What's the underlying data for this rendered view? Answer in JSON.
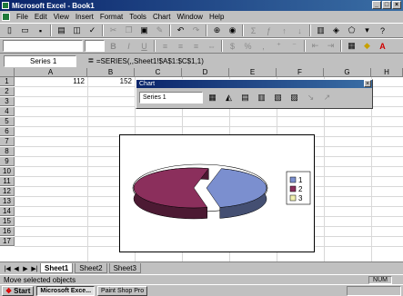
{
  "window": {
    "title": "Microsoft Excel - Book1",
    "min_label": "_",
    "max_label": "□",
    "close_label": "×"
  },
  "menu": [
    "File",
    "Edit",
    "View",
    "Insert",
    "Format",
    "Tools",
    "Chart",
    "Window",
    "Help"
  ],
  "formula_bar": {
    "name_box": "Series 1",
    "equals": "=",
    "formula": "=SERIES(,,Sheet1!$A$1:$C$1,1)"
  },
  "columns": [
    "A",
    "B",
    "C",
    "D",
    "E",
    "F",
    "G",
    "H"
  ],
  "rows": [
    "1",
    "2",
    "3",
    "4",
    "5",
    "6",
    "7",
    "8",
    "9",
    "10",
    "11",
    "12",
    "13",
    "14",
    "15",
    "16",
    "17"
  ],
  "cells": {
    "A1": "112",
    "B1": "152"
  },
  "chart_toolbar": {
    "title": "Chart",
    "close_label": "×",
    "object_select": "Series 1"
  },
  "chart_data": {
    "type": "pie",
    "values": [
      112,
      152,
      null
    ],
    "legend": [
      "1",
      "2",
      "3"
    ],
    "legend_position": "right",
    "colors": [
      "#7b8fcf",
      "#8b2f5c",
      "#f0f0b0"
    ],
    "style": "3-D exploded pie"
  },
  "sheet_tabs": [
    "Sheet1",
    "Sheet2",
    "Sheet3"
  ],
  "status": {
    "left": "Move selected objects",
    "num": "NUM"
  },
  "taskbar": {
    "start": "Start",
    "items": [
      "Microsoft Exce...",
      "Paint Shop Pro"
    ]
  }
}
